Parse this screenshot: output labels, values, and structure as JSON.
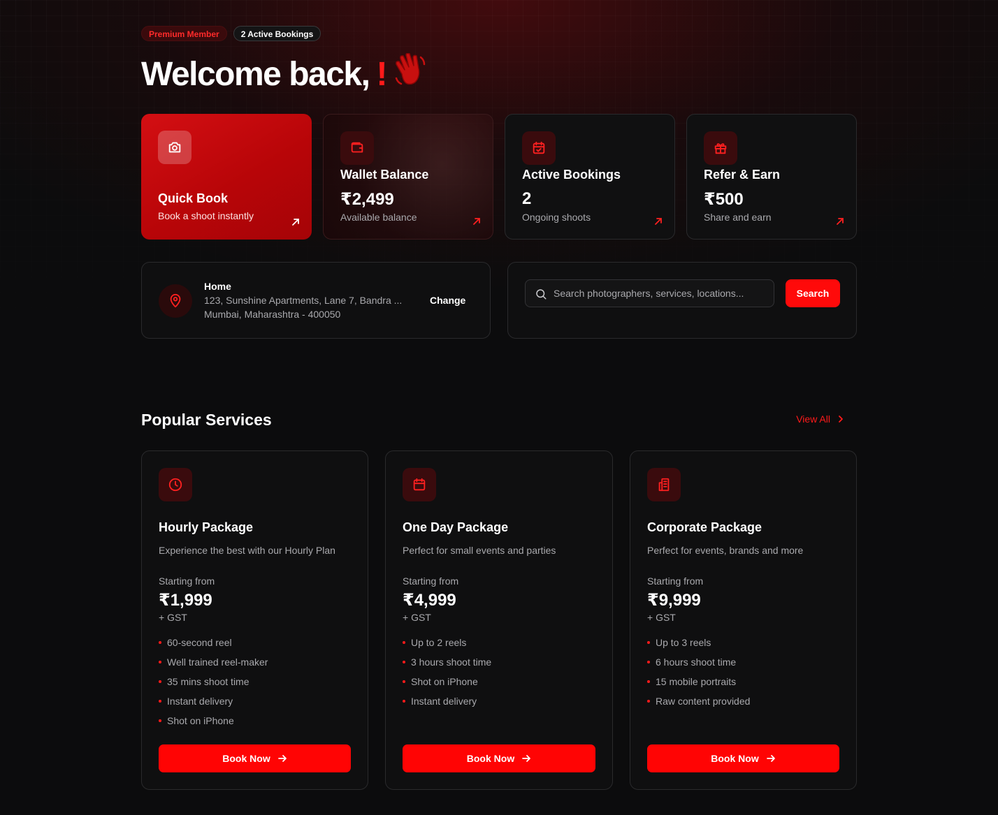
{
  "header": {
    "badge_premium": "Premium Member",
    "badge_bookings": "2 Active Bookings",
    "welcome": "Welcome back,",
    "welcome_punct": "!",
    "wave_emoji": "👋"
  },
  "cards": {
    "quick": {
      "title": "Quick Book",
      "sub": "Book a shoot instantly",
      "icon": "camera-icon"
    },
    "wallet": {
      "title": "Wallet Balance",
      "value": "₹2,499",
      "sub": "Available balance",
      "icon": "wallet-icon"
    },
    "bookings": {
      "title": "Active Bookings",
      "value": "2",
      "sub": "Ongoing shoots",
      "icon": "calendar-check-icon"
    },
    "refer": {
      "title": "Refer & Earn",
      "value": "₹500",
      "sub": "Share and earn",
      "icon": "gift-icon"
    }
  },
  "location": {
    "label": "Home",
    "line1": "123, Sunshine Apartments, Lane 7, Bandra ...",
    "line2": "Mumbai, Maharashtra - 400050",
    "change": "Change"
  },
  "search": {
    "placeholder": "Search photographers, services, locations...",
    "button": "Search"
  },
  "services": {
    "title": "Popular Services",
    "view_all": "View All",
    "items": [
      {
        "name": "Hourly Package",
        "desc": "Experience the best with our Hourly Plan",
        "from": "Starting from",
        "price": "₹1,999",
        "gst": "+ GST",
        "features": [
          "60-second reel",
          "Well trained reel-maker",
          "35 mins shoot time",
          "Instant delivery",
          "Shot on iPhone"
        ],
        "button": "Book Now",
        "icon": "clock-icon"
      },
      {
        "name": "One Day Package",
        "desc": "Perfect for small events and parties",
        "from": "Starting from",
        "price": "₹4,999",
        "gst": "+ GST",
        "features": [
          "Up to 2 reels",
          "3 hours shoot time",
          "Shot on iPhone",
          "Instant delivery"
        ],
        "button": "Book Now",
        "icon": "calendar-icon"
      },
      {
        "name": "Corporate Package",
        "desc": "Perfect for events, brands and more",
        "from": "Starting from",
        "price": "₹9,999",
        "gst": "+ GST",
        "features": [
          "Up to 3 reels",
          "6 hours shoot time",
          "15 mobile portraits",
          "Raw content provided"
        ],
        "button": "Book Now",
        "icon": "building-icon"
      }
    ]
  },
  "colors": {
    "accent": "#ff0a0a",
    "background": "#0c0c0d",
    "card_border": "#2a2a2c"
  }
}
